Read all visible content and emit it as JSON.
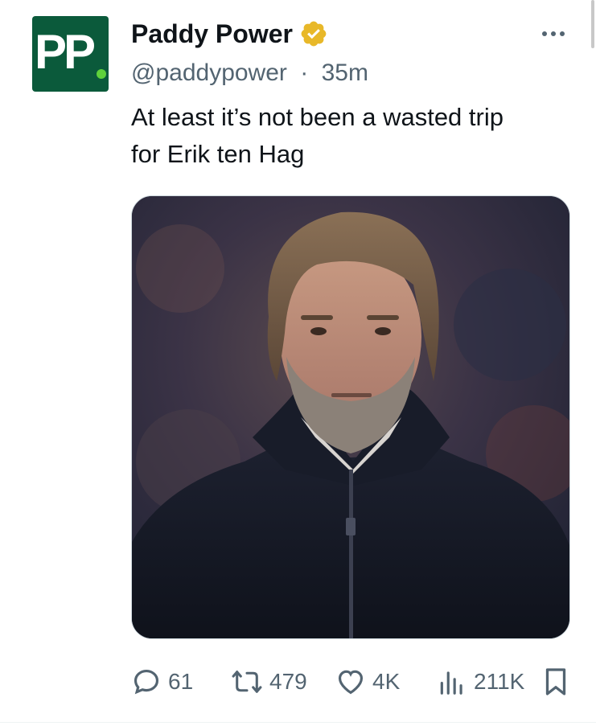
{
  "tweet": {
    "avatar_text": "PP",
    "display_name": "Paddy Power",
    "handle": "@paddypower",
    "separator": "·",
    "time": "35m",
    "text_line1": "At least it’s not been a wasted trip",
    "text_line2": "for Erik ten Hag",
    "verified_icon": "verified-badge-icon",
    "more_icon": "more-options-icon"
  },
  "media": {
    "icon": "photo-man-in-black-jacket"
  },
  "actions": {
    "replies": "61",
    "reposts": "479",
    "likes": "4K",
    "views": "211K"
  },
  "colors": {
    "avatar_bg": "#0b5a3b",
    "avatar_dot": "#5fd13b",
    "verified": "#e8b829",
    "secondary_text": "#536471"
  }
}
